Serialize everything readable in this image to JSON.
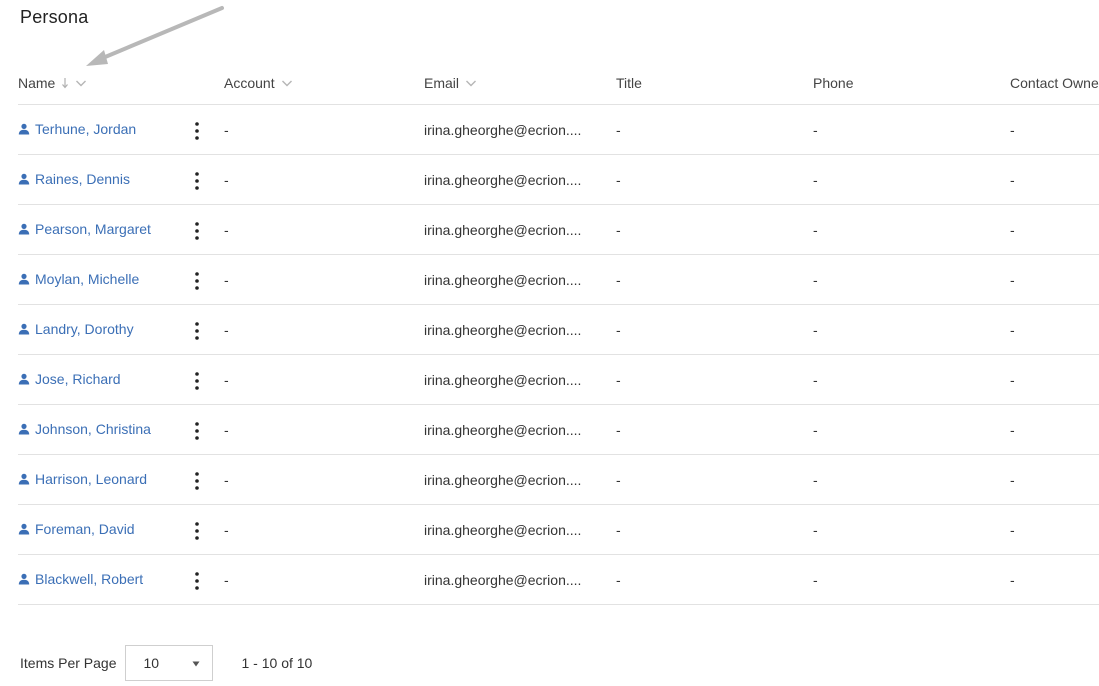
{
  "page": {
    "title": "Persona"
  },
  "table": {
    "columns": [
      {
        "label": "Name",
        "sortable": true,
        "sorted": "desc",
        "has_menu": true
      },
      {
        "label": "Account",
        "has_menu": true
      },
      {
        "label": "Email",
        "has_menu": true
      },
      {
        "label": "Title"
      },
      {
        "label": "Phone"
      },
      {
        "label": "Contact Owner"
      }
    ],
    "rows": [
      {
        "name": "Terhune, Jordan",
        "account": "-",
        "email": "irina.gheorghe@ecrion....",
        "title": "-",
        "phone": "-",
        "owner": "-"
      },
      {
        "name": "Raines, Dennis",
        "account": "-",
        "email": "irina.gheorghe@ecrion....",
        "title": "-",
        "phone": "-",
        "owner": "-"
      },
      {
        "name": "Pearson, Margaret",
        "account": "-",
        "email": "irina.gheorghe@ecrion....",
        "title": "-",
        "phone": "-",
        "owner": "-"
      },
      {
        "name": "Moylan, Michelle",
        "account": "-",
        "email": "irina.gheorghe@ecrion....",
        "title": "-",
        "phone": "-",
        "owner": "-"
      },
      {
        "name": "Landry, Dorothy",
        "account": "-",
        "email": "irina.gheorghe@ecrion....",
        "title": "-",
        "phone": "-",
        "owner": "-"
      },
      {
        "name": "Jose, Richard",
        "account": "-",
        "email": "irina.gheorghe@ecrion....",
        "title": "-",
        "phone": "-",
        "owner": "-"
      },
      {
        "name": "Johnson, Christina",
        "account": "-",
        "email": "irina.gheorghe@ecrion....",
        "title": "-",
        "phone": "-",
        "owner": "-"
      },
      {
        "name": "Harrison, Leonard",
        "account": "-",
        "email": "irina.gheorghe@ecrion....",
        "title": "-",
        "phone": "-",
        "owner": "-"
      },
      {
        "name": "Foreman, David",
        "account": "-",
        "email": "irina.gheorghe@ecrion....",
        "title": "-",
        "phone": "-",
        "owner": "-"
      },
      {
        "name": "Blackwell, Robert",
        "account": "-",
        "email": "irina.gheorghe@ecrion....",
        "title": "-",
        "phone": "-",
        "owner": "-"
      }
    ]
  },
  "pagination": {
    "items_per_page_label": "Items Per Page",
    "items_per_page_value": "10",
    "range_text": "1 - 10 of 10"
  },
  "colors": {
    "link": "#3b6fb6",
    "border": "#e2e2e2",
    "annotation_arrow": "#b8b8b8"
  },
  "icons": {
    "row_icon": "person-icon",
    "row_menu": "kebab-menu-icon",
    "column_menu": "chevron-down-icon",
    "sort": "sort-down-arrow-icon",
    "annotation": "annotation-arrow-icon"
  }
}
